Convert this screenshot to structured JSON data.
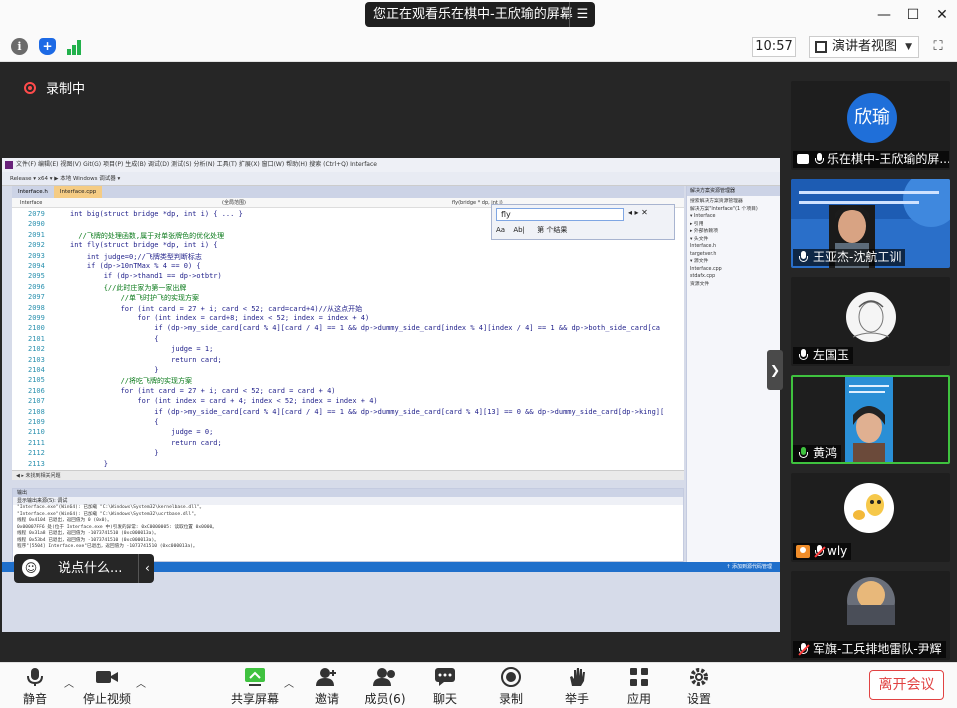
{
  "titlebar": {
    "share_title": "您正在观看乐在棋中-王欣瑜的屏幕",
    "share_menu_icon": "menu-lines-icon"
  },
  "infobar": {
    "time": "10:57",
    "view_mode": "演讲者视图"
  },
  "recording": {
    "label": "录制中"
  },
  "vs": {
    "menu": "文件(F)  编辑(E)  视图(V)  Git(G)  项目(P)  生成(B)  调试(D)  测试(S)  分析(N)  工具(T)  扩展(X)  窗口(W)  帮助(H)  搜索 (Ctrl+Q)     Interface",
    "tool": "Release  ▾   x64  ▾   ▶ 本地 Windows 调试器 ▾",
    "tabs": [
      "Interface.h",
      "Interface.cpp"
    ],
    "nav": [
      "Interface",
      "(全局范围)",
      "fly(bridge * dp, int i)"
    ],
    "lines": [
      {
        "n": "2079",
        "t": "int big(struct bridge *dp, int i) { ... }",
        "c": "kw"
      },
      {
        "n": "2090",
        "t": "",
        "c": "kw"
      },
      {
        "n": "2091",
        "t": "  //飞牌的处理函数,属于对单张牌色的优化处理",
        "c": "cm"
      },
      {
        "n": "2092",
        "t": "int fly(struct bridge *dp, int i) {",
        "c": "kw"
      },
      {
        "n": "2093",
        "t": "    int judge=0;//飞牌类型判断标志",
        "c": "kw"
      },
      {
        "n": "2094",
        "t": "    if (dp->10nTMax % 4 == 0) {",
        "c": "kw"
      },
      {
        "n": "2095",
        "t": "        if (dp->thand1 == dp->otbtr)",
        "c": "kw"
      },
      {
        "n": "2096",
        "t": "        {//此时庄家为第一家出牌",
        "c": "cm"
      },
      {
        "n": "2097",
        "t": "            //单飞时护飞的实现方案",
        "c": "cm"
      },
      {
        "n": "2098",
        "t": "            for (int card = 27 + i; card < 52; card=card+4)//从这点开始",
        "c": "kw"
      },
      {
        "n": "2099",
        "t": "                for (int index = card+8; index < 52; index = index + 4)",
        "c": "kw"
      },
      {
        "n": "2100",
        "t": "                    if (dp->my_side_card[card % 4][card / 4] == 1 && dp->dummy_side_card[index % 4][index / 4] == 1 && dp->both_side_card[ca",
        "c": "kw"
      },
      {
        "n": "2101",
        "t": "                    {",
        "c": "kw"
      },
      {
        "n": "2102",
        "t": "                        judge = 1;",
        "c": "kw"
      },
      {
        "n": "2103",
        "t": "                        return card;",
        "c": "kw"
      },
      {
        "n": "2104",
        "t": "                    }",
        "c": "kw"
      },
      {
        "n": "2105",
        "t": "            //将吃飞牌的实现方案",
        "c": "cm"
      },
      {
        "n": "2106",
        "t": "            for (int card = 27 + i; card < 52; card = card + 4)",
        "c": "kw"
      },
      {
        "n": "2107",
        "t": "                for (int index = card + 4; index < 52; index = index + 4)",
        "c": "kw"
      },
      {
        "n": "2108",
        "t": "                    if (dp->my_side_card[card % 4][card / 4] == 1 && dp->dummy_side_card[card % 4][13] == 0 && dp->dummy_side_card[dp->king][",
        "c": "kw"
      },
      {
        "n": "2109",
        "t": "                    {",
        "c": "kw"
      },
      {
        "n": "2110",
        "t": "                        judge = 0;",
        "c": "kw"
      },
      {
        "n": "2111",
        "t": "                        return card;",
        "c": "kw"
      },
      {
        "n": "2112",
        "t": "                    }",
        "c": "kw"
      },
      {
        "n": "2113",
        "t": "        }",
        "c": "kw"
      }
    ],
    "find": {
      "value": "fly",
      "option_a": "Aa",
      "option_b": "Ab|",
      "option_c": "当前文档",
      "status": "第 个结果",
      "options": "◂  ▸  ✕"
    },
    "hscroll": "◀  ▸  未找到相关问题",
    "output": {
      "title": "输出",
      "source": "显示输出来源(S): 调试",
      "lines": [
        "\"Interface.exe\"(Win64): 已加载 \"C:\\Windows\\System32\\kernelbase.dll\"。",
        "\"Interface.exe\"(Win64): 已加载 \"C:\\Windows\\System32\\ucrtbase.dll\"。",
        "线程 0x4104 已退出，返回值为 0 (0x0)。",
        "0x00007FF6 处(位于 Interface.exe 中)引发的异常: 0xC0000005: 读取位置 0x0000。",
        "线程 0x31a8 已退出，返回值为 -1073741510 (0xc000013a)。",
        "线程 0x53b4 已退出，返回值为 -1073741510 (0xc000013a)。",
        "程序\"[5504] Interface.exe\"已退出，返回值为 -1073741510 (0xc000013a)。"
      ]
    },
    "solution": {
      "title": "解决方案资源管理器",
      "items": [
        "搜索解决方案资源管理器",
        "解决方案\"Interface\"(1 个项目)",
        "▾ Interface",
        "  ▸ 引用",
        "  ▸ 外部依赖项",
        "  ▾ 头文件",
        "      Interface.h",
        "      targetver.h",
        "  ▾ 源文件",
        "      Interface.cpp",
        "      stdafx.cpp",
        "    资源文件"
      ]
    },
    "status": "↑ 添加到源代码管理"
  },
  "chat": {
    "label": "说点什么..."
  },
  "participants": [
    {
      "name": "乐在棋中-王欣瑜的屏...",
      "avatar": "欣瑜",
      "mic": "on",
      "sharing": true
    },
    {
      "name": "王亚杰-沈航工训",
      "mic": "on"
    },
    {
      "name": "左国玉",
      "mic": "on"
    },
    {
      "name": "黄鸿",
      "mic": "green",
      "active": true
    },
    {
      "name": "wly",
      "mic": "off",
      "person": true
    },
    {
      "name": "军旗-工兵排地雷队-尹辉",
      "mic": "off"
    }
  ],
  "bottom": {
    "mute": "静音",
    "video": "停止视频",
    "share": "共享屏幕",
    "invite": "邀请",
    "members": "成员(6)",
    "chat": "聊天",
    "record": "录制",
    "raise": "举手",
    "apps": "应用",
    "settings": "设置",
    "leave": "离开会议"
  },
  "colors": {
    "accent": "#1f6fd9",
    "danger": "#e14343",
    "recording": "#ff4b4b",
    "active_speaker": "#3fc23f"
  }
}
